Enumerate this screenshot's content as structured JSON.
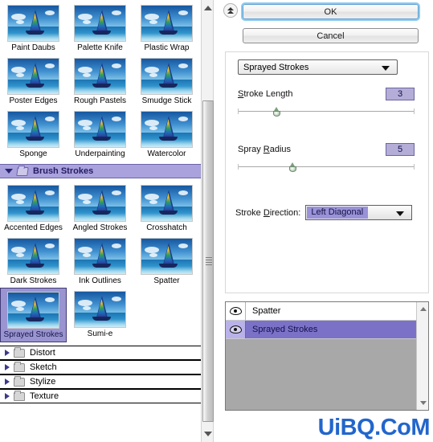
{
  "left_panel": {
    "name": "filter-gallery-browser",
    "top_grid_rows": [
      [
        {
          "label": "Paint Daubs",
          "selected": false
        },
        {
          "label": "Palette Knife",
          "selected": false
        },
        {
          "label": "Plastic Wrap",
          "selected": false
        }
      ],
      [
        {
          "label": "Poster Edges",
          "selected": false
        },
        {
          "label": "Rough Pastels",
          "selected": false
        },
        {
          "label": "Smudge Stick",
          "selected": false
        }
      ],
      [
        {
          "label": "Sponge",
          "selected": false
        },
        {
          "label": "Underpainting",
          "selected": false
        },
        {
          "label": "Watercolor",
          "selected": false
        }
      ]
    ],
    "open_category": {
      "label": "Brush Strokes",
      "expanded": true,
      "folder_icon": "folder-open-icon",
      "disclosure_icon": "triangle-down-icon",
      "rows": [
        [
          {
            "label": "Accented Edges",
            "selected": false
          },
          {
            "label": "Angled Strokes",
            "selected": false
          },
          {
            "label": "Crosshatch",
            "selected": false
          }
        ],
        [
          {
            "label": "Dark Strokes",
            "selected": false
          },
          {
            "label": "Ink Outlines",
            "selected": false
          },
          {
            "label": "Spatter",
            "selected": false
          }
        ],
        [
          {
            "label": "Sprayed Strokes",
            "selected": true
          },
          {
            "label": "Sumi-e",
            "selected": false
          }
        ]
      ]
    },
    "collapsed_categories": [
      {
        "label": "Distort",
        "folder_icon": "folder-closed-icon",
        "disclosure_icon": "triangle-right-icon"
      },
      {
        "label": "Sketch",
        "folder_icon": "folder-closed-icon",
        "disclosure_icon": "triangle-right-icon"
      },
      {
        "label": "Stylize",
        "folder_icon": "folder-closed-icon",
        "disclosure_icon": "triangle-right-icon"
      },
      {
        "label": "Texture",
        "folder_icon": "folder-closed-icon",
        "disclosure_icon": "triangle-right-icon"
      }
    ],
    "scrollbar": {
      "up_icon": "scroll-up-arrow-icon",
      "down_icon": "scroll-down-arrow-icon",
      "grip_icon": "scrollbar-grip-icon"
    }
  },
  "right_panel": {
    "collapse_button_icon": "double-chevron-up-icon",
    "ok_label": "OK",
    "cancel_label": "Cancel",
    "filter_select": {
      "value": "Sprayed Strokes",
      "arrow_icon": "chevron-down-icon"
    },
    "controls": [
      {
        "label": "Stroke Length",
        "mnemonic": "S",
        "value": "3",
        "slider_percent": 22
      },
      {
        "label": "Spray Radius",
        "mnemonic": "R",
        "value": "5",
        "slider_percent": 31
      }
    ],
    "stroke_direction": {
      "label": "Stroke Direction:",
      "mnemonic": "D",
      "value": "Left Diagonal",
      "arrow_icon": "chevron-down-icon"
    },
    "effects_list": {
      "items": [
        {
          "name": "Spatter",
          "visible": true,
          "selected": false,
          "eye_icon": "eye-visible-icon"
        },
        {
          "name": "Sprayed Strokes",
          "visible": true,
          "selected": true,
          "eye_icon": "eye-visible-icon"
        }
      ],
      "scrollbar": {
        "up_icon": "scroll-up-arrow-icon",
        "down_icon": "scroll-down-arrow-icon"
      }
    }
  },
  "watermark": {
    "text": "UiBQ.CoM",
    "color": "#2266cc"
  },
  "colors": {
    "selection_purple": "#9a94d0",
    "list_selection": "#7b72c8",
    "value_field_bg": "#b3add8",
    "category_header_bg": "#a9a2dd",
    "focus_blue": "#8ecbf0"
  }
}
